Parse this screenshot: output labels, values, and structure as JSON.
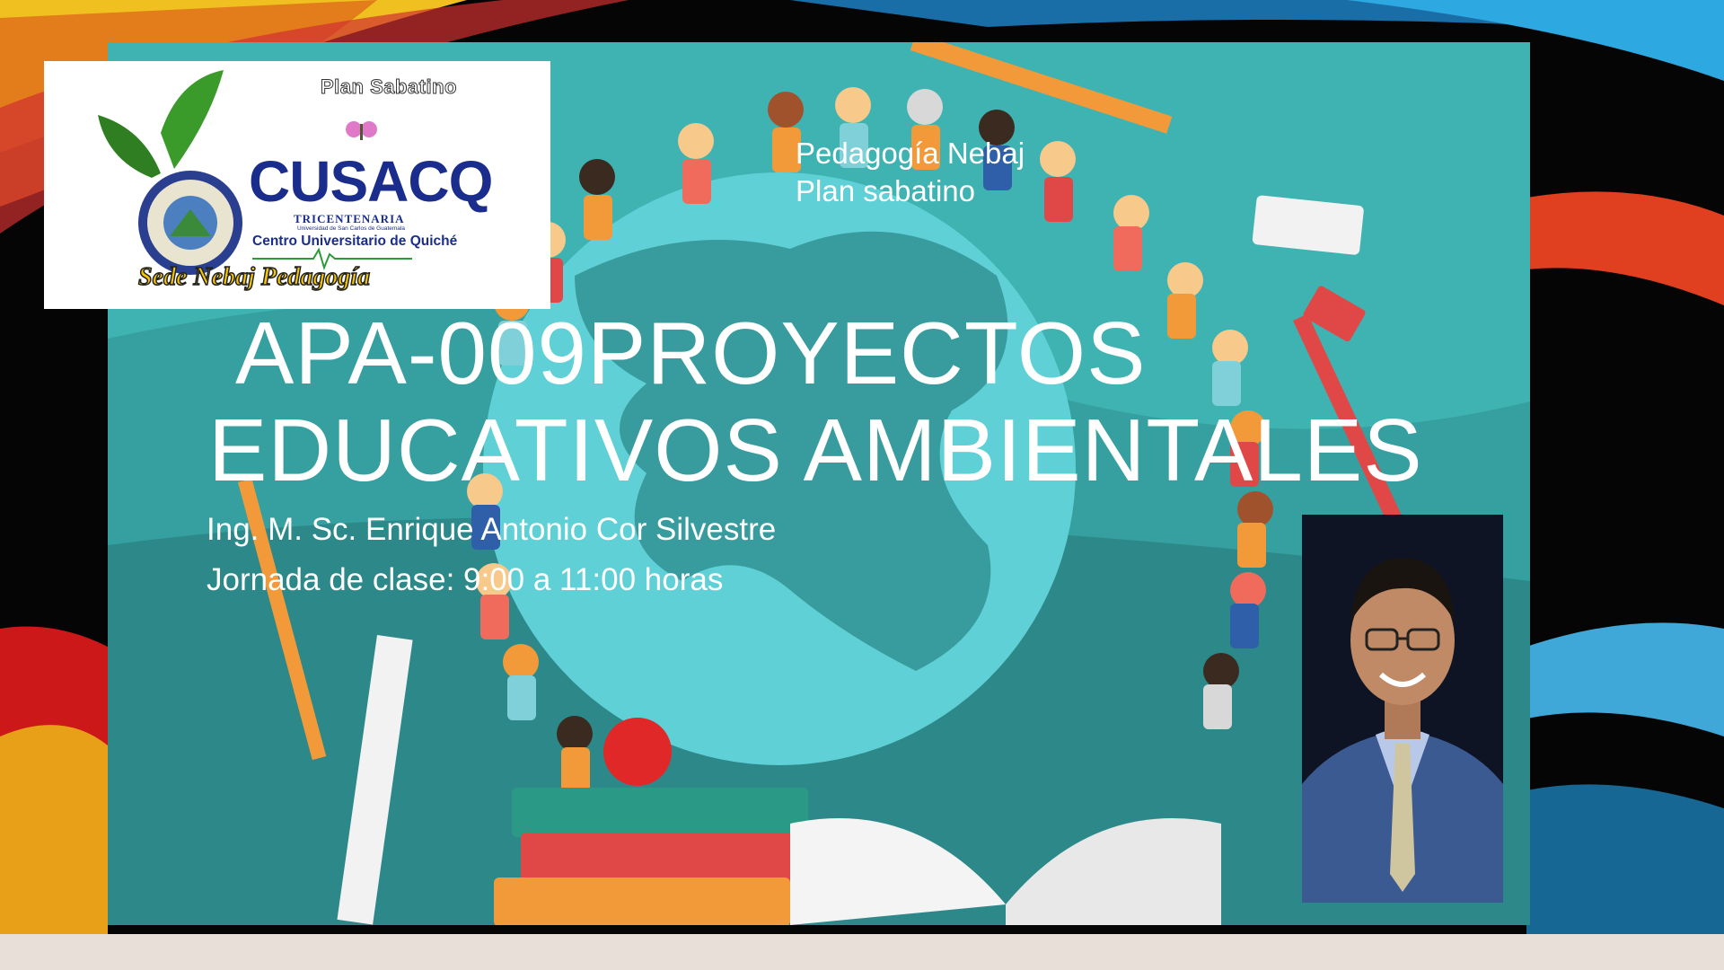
{
  "slide": {
    "header_line1": "Pedagogía Nebaj",
    "header_line2": "Plan sabatino",
    "title_line1": "APA-009PROYECTOS",
    "title_line2": "EDUCATIVOS AMBIENTALES",
    "instructor": "Ing. M. Sc. Enrique Antonio Cor Silvestre",
    "schedule": "Jornada de clase: 9:00 a 11:00 horas"
  },
  "logo": {
    "plan_label": "Plan Sabatino",
    "brand_name": "CUSACQ",
    "brand_line1": "TRICENTENARIA",
    "brand_line2": "Universidad de San Carlos de Guatemala",
    "brand_line3": "Centro Universitario de Quiché",
    "sede_label": "Sede Nebaj  Pedagogía"
  },
  "colors": {
    "teal_background": "#3fb3b2",
    "globe": "#5fd0d6",
    "title_text": "#ffffff",
    "brand_blue": "#1a2d8c"
  }
}
